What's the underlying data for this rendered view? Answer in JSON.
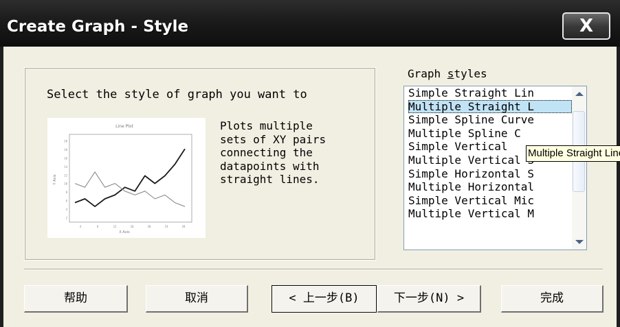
{
  "window": {
    "title": "Create Graph - Style",
    "close_label": "X"
  },
  "prompt": "Select the style of graph you want to",
  "preview": {
    "title": "Line Plot",
    "xlabel": "X Axis",
    "ylabel": "Y Axis",
    "x_ticks": [
      "4",
      "8",
      "12",
      "16",
      "20",
      "24",
      "28"
    ],
    "y_ticks": [
      "2",
      "4",
      "6",
      "8",
      "10",
      "12",
      "14",
      "16",
      "18",
      "20"
    ]
  },
  "chart_data": {
    "type": "line",
    "title": "Line Plot",
    "xlabel": "X Axis",
    "ylabel": "Y Axis",
    "x": [
      1,
      2,
      3,
      4,
      5,
      6,
      7,
      8,
      9,
      10,
      11,
      12
    ],
    "series": [
      {
        "values": [
          4,
          5,
          3,
          5,
          6,
          8,
          7,
          11,
          9,
          11,
          14,
          18
        ]
      },
      {
        "values": [
          9,
          8,
          12,
          8,
          9,
          7,
          6,
          7,
          5,
          6,
          4,
          3
        ]
      }
    ],
    "grid": false
  },
  "description": [
    "Plots multiple",
    "sets of XY pairs",
    "connecting the",
    "datapoints with",
    "straight lines."
  ],
  "list": {
    "label_prefix": "Graph ",
    "label_hotkey": "s",
    "label_suffix": "tyles",
    "items": [
      "Simple Straight Lin",
      "Multiple Straight L",
      "Simple Spline Curve",
      "Multiple Spline C",
      "Simple Vertical",
      "Multiple Vertical S",
      "Simple Horizontal S",
      "Multiple Horizontal",
      "Simple Vertical Mic",
      "Multiple Vertical M"
    ],
    "selected_index": 1
  },
  "tooltip": "Multiple Straight Lines",
  "buttons": {
    "help": "帮助",
    "cancel": "取消",
    "back": "< 上一步(B)",
    "next": "下一步(N) >",
    "finish": "完成"
  }
}
